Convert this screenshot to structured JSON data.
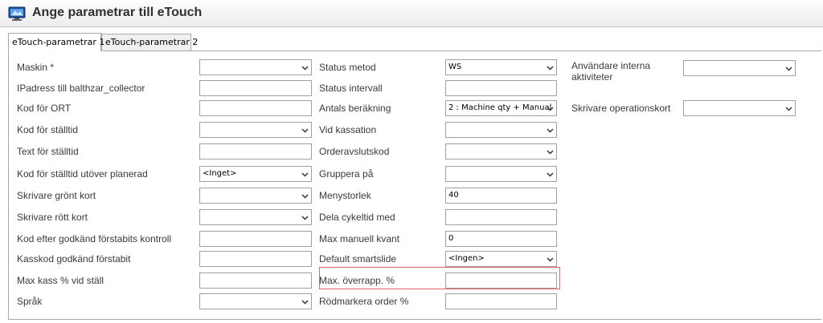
{
  "window": {
    "title": "Ange parametrar till eTouch"
  },
  "tabs": [
    {
      "label": "eTouch-parametrar 1"
    },
    {
      "label": "eTouch-parametrar 2"
    }
  ],
  "col1": [
    {
      "label": "Maskin *",
      "type": "select",
      "value": ""
    },
    {
      "label": "IPadress till balthzar_collector",
      "type": "text",
      "value": ""
    },
    {
      "label": "Kod för ORT",
      "type": "text",
      "value": ""
    },
    {
      "label": "Kod för ställtid",
      "type": "select",
      "value": ""
    },
    {
      "label": "Text för ställtid",
      "type": "text",
      "value": ""
    },
    {
      "label": "Kod för ställtid utöver planerad",
      "type": "select",
      "value": "<Inget>"
    },
    {
      "label": "Skrivare grönt kort",
      "type": "select",
      "value": ""
    },
    {
      "label": "Skrivare rött kort",
      "type": "select",
      "value": ""
    },
    {
      "label": "Kod efter godkänd förstabits kontroll",
      "type": "text",
      "value": ""
    },
    {
      "label": "Kasskod godkänd förstabit",
      "type": "text",
      "value": ""
    },
    {
      "label": "Max kass % vid ställ",
      "type": "text",
      "value": ""
    },
    {
      "label": "Språk",
      "type": "select",
      "value": ""
    }
  ],
  "col2": [
    {
      "label": "Status metod",
      "type": "select",
      "value": "WS"
    },
    {
      "label": "Status intervall",
      "type": "text",
      "value": ""
    },
    {
      "label": "Antals beräkning",
      "type": "select",
      "value": "2 : Machine qty + Manual"
    },
    {
      "label": "Vid kassation",
      "type": "select",
      "value": ""
    },
    {
      "label": "Orderavslutskod",
      "type": "select",
      "value": ""
    },
    {
      "label": "Gruppera på",
      "type": "select",
      "value": ""
    },
    {
      "label": "Menystorlek",
      "type": "text",
      "value": "40"
    },
    {
      "label": "Dela cykeltid med",
      "type": "text",
      "value": ""
    },
    {
      "label": "Max manuell kvant",
      "type": "text",
      "value": "0"
    },
    {
      "label": "Default smartslide",
      "type": "select",
      "value": "<Ingen>"
    },
    {
      "label": "Max. överrapp. %",
      "type": "text",
      "value": ""
    },
    {
      "label": "Rödmarkera order %",
      "type": "text",
      "value": ""
    }
  ],
  "col3": [
    {
      "label": "Användare interna aktiviteter",
      "type": "select",
      "value": ""
    },
    {
      "label": "Skrivare operationskort",
      "type": "select",
      "value": ""
    }
  ],
  "icons": {
    "app": "monitor-icon",
    "dropdown": "chevron-down-icon"
  },
  "colors": {
    "highlight": "#e0656d",
    "border": "#a0a0a0"
  }
}
